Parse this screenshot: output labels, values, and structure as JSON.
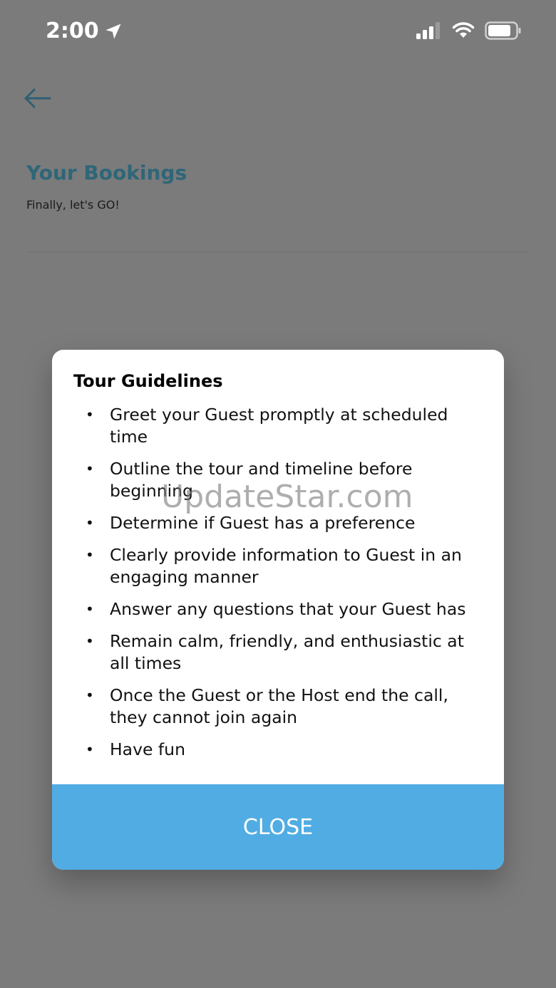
{
  "status_bar": {
    "time": "2:00",
    "icons": [
      "location-arrow-icon",
      "cellular-signal-icon",
      "wifi-icon",
      "battery-icon"
    ]
  },
  "header": {
    "back_icon": "arrow-left-icon",
    "title": "Your Bookings",
    "subtitle": "Finally, let's GO!"
  },
  "dialog": {
    "title": "Tour Guidelines",
    "items": [
      "Greet your Guest promptly at scheduled time",
      "Outline the tour and timeline before beginning",
      "Determine if Guest has a preference",
      "Clearly provide information to Guest in an engaging manner",
      "Answer any questions that your Guest has",
      "Remain calm, friendly, and enthusiastic at all times",
      "Once the Guest or the Host end the call, they cannot join again",
      "Have fun"
    ],
    "close_label": "CLOSE"
  },
  "watermark": "UpdateStar.com",
  "colors": {
    "overlay_background": "#7b7b7b",
    "title_teal": "#2e6678",
    "close_button": "#51ace3"
  }
}
